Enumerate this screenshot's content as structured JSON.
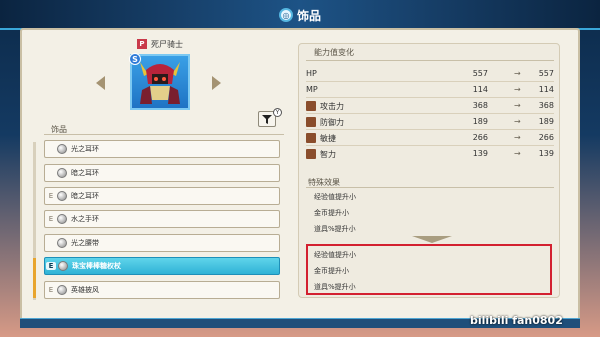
{
  "header": {
    "title": "饰品",
    "title_icon": "ring-crest-icon"
  },
  "character": {
    "badge": "P",
    "name": "死尸骑士",
    "rank": "S"
  },
  "list": {
    "label": "饰品",
    "items": [
      {
        "equipped": "",
        "name": "光之耳环",
        "selected": false
      },
      {
        "equipped": "",
        "name": "暗之耳环",
        "selected": false
      },
      {
        "equipped": "E",
        "name": "暗之耳环",
        "selected": false
      },
      {
        "equipped": "E",
        "name": "水之手环",
        "selected": false
      },
      {
        "equipped": "",
        "name": "光之腰带",
        "selected": false
      },
      {
        "equipped": "E",
        "name": "珠宝棒棒糖权杖",
        "selected": true
      },
      {
        "equipped": "E",
        "name": "英雄披风",
        "selected": false
      }
    ]
  },
  "stats": {
    "heading": "能力值变化",
    "arrow": "→",
    "rows": [
      {
        "name": "HP",
        "icon": "",
        "current": "557",
        "new": "557"
      },
      {
        "name": "MP",
        "icon": "",
        "current": "114",
        "new": "114"
      },
      {
        "name": "攻击力",
        "icon": "sword-icon",
        "current": "368",
        "new": "368"
      },
      {
        "name": "防御力",
        "icon": "shield-icon",
        "current": "189",
        "new": "189"
      },
      {
        "name": "敏捷",
        "icon": "boot-icon",
        "current": "266",
        "new": "266"
      },
      {
        "name": "智力",
        "icon": "book-icon",
        "current": "139",
        "new": "139"
      }
    ]
  },
  "special": {
    "heading": "特殊效果",
    "current_effects": [
      "经验值提升小",
      "金币提升小",
      "道具%提升小"
    ],
    "new_effects": [
      "经验值提升小",
      "金币提升小",
      "道具%提升小"
    ]
  },
  "watermark": "bilibili fan0802",
  "colors": {
    "selected": "#2fb3d6",
    "highlight": "#d32030",
    "header": "#17406a"
  }
}
